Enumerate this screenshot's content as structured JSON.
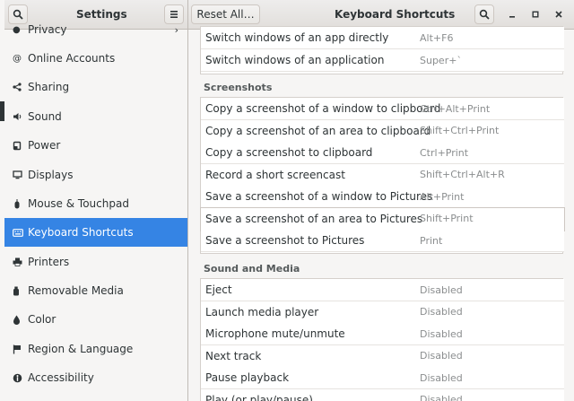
{
  "header": {
    "left_title": "Settings",
    "reset_label": "Reset All…",
    "title": "Keyboard Shortcuts"
  },
  "sidebar": {
    "items": [
      {
        "label": "Privacy",
        "icon": "privacy-icon"
      },
      {
        "label": "Online Accounts",
        "icon": "online-accounts-icon"
      },
      {
        "label": "Sharing",
        "icon": "share-icon"
      },
      {
        "label": "Sound",
        "icon": "sound-icon"
      },
      {
        "label": "Power",
        "icon": "power-icon"
      },
      {
        "label": "Displays",
        "icon": "display-icon"
      },
      {
        "label": "Mouse & Touchpad",
        "icon": "mouse-icon"
      },
      {
        "label": "Keyboard Shortcuts",
        "icon": "keyboard-icon",
        "active": true
      },
      {
        "label": "Printers",
        "icon": "printer-icon"
      },
      {
        "label": "Removable Media",
        "icon": "removable-media-icon"
      },
      {
        "label": "Color",
        "icon": "color-icon"
      },
      {
        "label": "Region & Language",
        "icon": "region-icon"
      },
      {
        "label": "Accessibility",
        "icon": "accessibility-icon"
      }
    ]
  },
  "main": {
    "top_rows": [
      {
        "label": "Switch windows of an app directly",
        "accel": "Alt+F6"
      },
      {
        "label": "Switch windows of an application",
        "accel": "Super+`"
      }
    ],
    "screenshots_title": "Screenshots",
    "screenshots": [
      {
        "label": "Copy a screenshot of a window to clipboard",
        "accel": "Ctrl+Alt+Print"
      },
      {
        "label": "Copy a screenshot of an area to clipboard",
        "accel": "Shift+Ctrl+Print"
      },
      {
        "label": "Copy a screenshot to clipboard",
        "accel": "Ctrl+Print"
      },
      {
        "label": "Record a short screencast",
        "accel": "Shift+Ctrl+Alt+R"
      },
      {
        "label": "Save a screenshot of a window to Pictures",
        "accel": "Alt+Print"
      },
      {
        "label": "Save a screenshot of an area to Pictures",
        "accel": "Shift+Print"
      },
      {
        "label": "Save a screenshot to Pictures",
        "accel": "Print"
      }
    ],
    "media_title": "Sound and Media",
    "media": [
      {
        "label": "Eject",
        "accel": "Disabled"
      },
      {
        "label": "Launch media player",
        "accel": "Disabled"
      },
      {
        "label": "Microphone mute/unmute",
        "accel": "Disabled"
      },
      {
        "label": "Next track",
        "accel": "Disabled"
      },
      {
        "label": "Pause playback",
        "accel": "Disabled"
      },
      {
        "label": "Play (or play/pause)",
        "accel": "Disabled"
      }
    ]
  },
  "colors": {
    "accent": "#3584e4",
    "accel_text": "#8b8e8f"
  }
}
